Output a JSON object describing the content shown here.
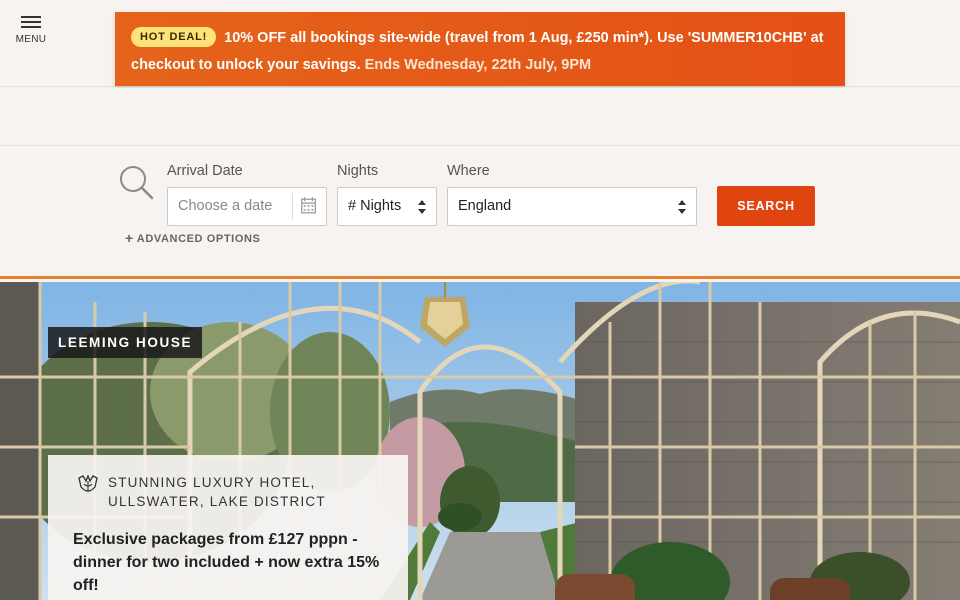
{
  "header": {
    "menu_label": "MENU"
  },
  "promo": {
    "badge": "HOT DEAL!",
    "text": "10% OFF all bookings site-wide (travel from 1 Aug, £250 min*). Use 'SUMMER10CHB' at checkout to unlock your savings.",
    "ends": "Ends Wednesday, 22th July, 9PM",
    "accent": "#e45a18"
  },
  "search": {
    "arrival_label": "Arrival Date",
    "arrival_placeholder": "Choose a date",
    "nights_label": "Nights",
    "nights_value": "# Nights",
    "where_label": "Where",
    "where_value": "England",
    "button": "SEARCH",
    "advanced": "ADVANCED OPTIONS",
    "button_color": "#e0450f"
  },
  "hero": {
    "hotel_name": "LEEMING HOUSE",
    "subtitle_line1": "STUNNING LUXURY HOTEL,",
    "subtitle_line2": "ULLSWATER, LAKE DISTRICT",
    "offer": "Exclusive packages from £127 pppn - dinner for two included + now extra 15% off!"
  }
}
